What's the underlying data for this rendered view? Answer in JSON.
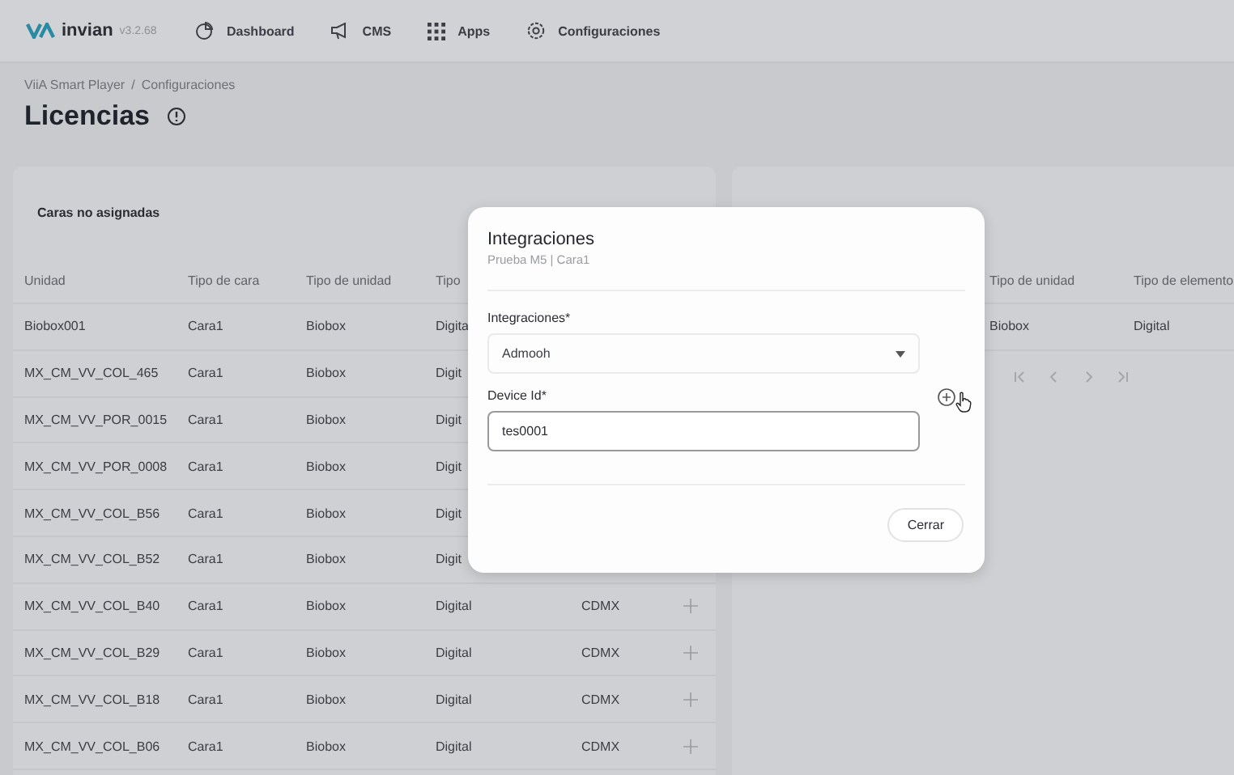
{
  "header": {
    "brand": "invian",
    "version": "v3.2.68",
    "nav": [
      {
        "label": "Dashboard"
      },
      {
        "label": "CMS"
      },
      {
        "label": "Apps"
      },
      {
        "label": "Configuraciones"
      }
    ]
  },
  "breadcrumb": [
    "ViiA Smart Player",
    "/",
    "Configuraciones"
  ],
  "page_title": "Licencias",
  "left_panel": {
    "title": "Caras no asignadas",
    "columns": [
      "Unidad",
      "Tipo de cara",
      "Tipo de unidad",
      "Tipo"
    ],
    "rows": [
      {
        "unidad": "Biobox001",
        "tipo_cara": "Cara1",
        "tipo_unidad": "Biobox",
        "tipo_elemento": "Digita"
      },
      {
        "unidad": "MX_CM_VV_COL_465",
        "tipo_cara": "Cara1",
        "tipo_unidad": "Biobox",
        "tipo_elemento": "Digit"
      },
      {
        "unidad": "MX_CM_VV_POR_0015",
        "tipo_cara": "Cara1",
        "tipo_unidad": "Biobox",
        "tipo_elemento": "Digit"
      },
      {
        "unidad": "MX_CM_VV_POR_0008",
        "tipo_cara": "Cara1",
        "tipo_unidad": "Biobox",
        "tipo_elemento": "Digit"
      },
      {
        "unidad": "MX_CM_VV_COL_B56",
        "tipo_cara": "Cara1",
        "tipo_unidad": "Biobox",
        "tipo_elemento": "Digit"
      },
      {
        "unidad": "MX_CM_VV_COL_B52",
        "tipo_cara": "Cara1",
        "tipo_unidad": "Biobox",
        "tipo_elemento": "Digit"
      },
      {
        "unidad": "MX_CM_VV_COL_B40",
        "tipo_cara": "Cara1",
        "tipo_unidad": "Biobox",
        "tipo_elemento": "Digital",
        "column_5": "CDMX"
      },
      {
        "unidad": "MX_CM_VV_COL_B29",
        "tipo_cara": "Cara1",
        "tipo_unidad": "Biobox",
        "tipo_elemento": "Digital",
        "column_5": "CDMX"
      },
      {
        "unidad": "MX_CM_VV_COL_B18",
        "tipo_cara": "Cara1",
        "tipo_unidad": "Biobox",
        "tipo_elemento": "Digital",
        "column_5": "CDMX"
      },
      {
        "unidad": "MX_CM_VV_COL_B06",
        "tipo_cara": "Cara1",
        "tipo_unidad": "Biobox",
        "tipo_elemento": "Digital",
        "column_5": "CDMX"
      }
    ]
  },
  "right_panel": {
    "columns": [
      "Tipo de unidad",
      "Tipo de elemento"
    ],
    "rows": [
      {
        "tipo_unidad": "Biobox",
        "tipo_elemento": "Digital"
      }
    ]
  },
  "modal": {
    "title": "Integraciones",
    "subtitle": "Prueba M5 | Cara1",
    "fields": [
      {
        "label": "Integraciones*",
        "kind": "select",
        "value": "Admooh"
      },
      {
        "label": "Device Id*",
        "kind": "text",
        "value": "tes0001"
      }
    ],
    "close_button": "Cerrar"
  }
}
